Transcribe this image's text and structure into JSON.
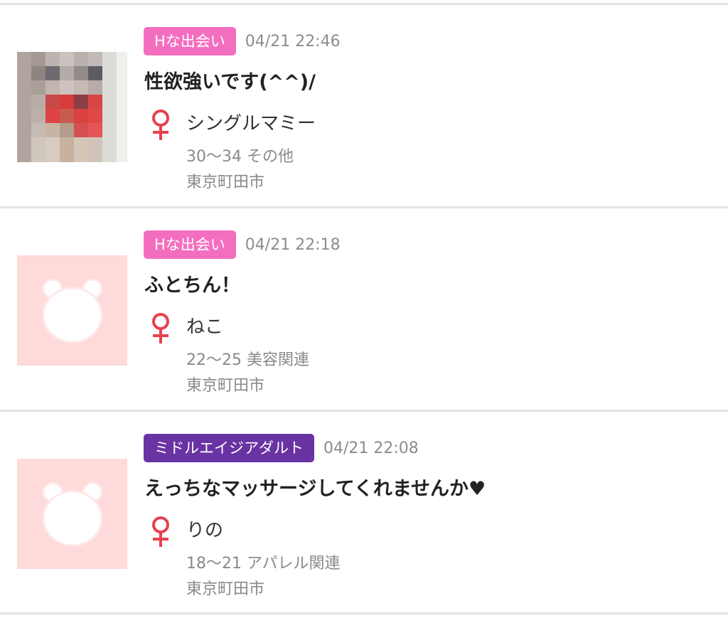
{
  "colors": {
    "tag_h": "#f46ec0",
    "tag_middle": "#6a33a3",
    "gender_female": "#e84050",
    "divider": "#e3e3e3",
    "noimage_bg": "#ffdada"
  },
  "posts": [
    {
      "tag": "Hな出会い",
      "tag_color": "#f46ec0",
      "date": "04/21 22:46",
      "title": "性欲強いです(^^)/",
      "gender_icon": "female-icon",
      "name": "シングルマミー",
      "age_job": "30～34 その他",
      "area": "東京町田市",
      "thumbnail": "photo"
    },
    {
      "tag": "Hな出会い",
      "tag_color": "#f46ec0",
      "date": "04/21 22:18",
      "title": "ふとちん！",
      "gender_icon": "female-icon",
      "name": "ねこ",
      "age_job": "22～25 美容関連",
      "area": "東京町田市",
      "thumbnail": "noimage-bear-icon"
    },
    {
      "tag": "ミドルエイジアダルト",
      "tag_color": "#6a33a3",
      "date": "04/21 22:08",
      "title": "えっちなマッサージしてくれませんか♥",
      "gender_icon": "female-icon",
      "name": "りの",
      "age_job": "18～21 アパレル関連",
      "area": "東京町田市",
      "thumbnail": "noimage-bear-icon"
    }
  ]
}
